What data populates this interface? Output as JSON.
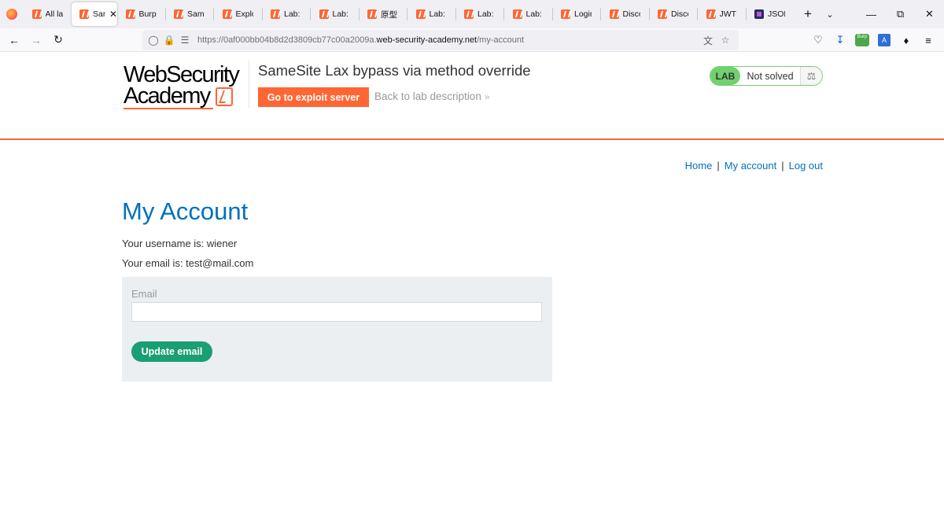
{
  "browser": {
    "tabs": [
      {
        "title": "All lab",
        "icon": "burp-favicon",
        "active": false
      },
      {
        "title": "Sam",
        "icon": "burp-favicon",
        "active": true
      },
      {
        "title": "Burp S",
        "icon": "burp-favicon",
        "active": false
      },
      {
        "title": "SameS",
        "icon": "burp-favicon",
        "active": false
      },
      {
        "title": "Exploi",
        "icon": "burp-favicon",
        "active": false
      },
      {
        "title": "Lab: S",
        "icon": "burp-favicon",
        "active": false
      },
      {
        "title": "Lab: D",
        "icon": "burp-favicon",
        "active": false
      },
      {
        "title": "原型污",
        "icon": "burp-favicon",
        "active": false
      },
      {
        "title": "Lab: C",
        "icon": "burp-favicon",
        "active": false
      },
      {
        "title": "Lab: D",
        "icon": "burp-favicon",
        "active": false
      },
      {
        "title": "Lab: D",
        "icon": "burp-favicon",
        "active": false
      },
      {
        "title": "Login",
        "icon": "burp-favicon",
        "active": false
      },
      {
        "title": "Discov",
        "icon": "burp-favicon",
        "active": false
      },
      {
        "title": "Discov",
        "icon": "burp-favicon",
        "active": false
      },
      {
        "title": "JWT at",
        "icon": "burp-favicon",
        "active": false
      },
      {
        "title": "JSON",
        "icon": "json-favicon",
        "active": false
      }
    ],
    "url_prefix": "https://0af000bb04b8d2d3809cb77c00a2009a.",
    "url_domain": "web-security-academy.net",
    "url_path": "/my-account"
  },
  "header": {
    "logo_line1": "WebSecurity",
    "logo_line2": "Academy",
    "lab_title": "SameSite Lax bypass via method override",
    "exploit_button": "Go to exploit server",
    "back_link": "Back to lab description",
    "status_badge": "LAB",
    "status_text": "Not solved",
    "colors": {
      "accent": "#ff6633",
      "lab_green": "#70d16d",
      "link_blue": "#0071bc",
      "button_green": "#1a9e73"
    }
  },
  "nav": {
    "home": "Home",
    "my_account": "My account",
    "log_out": "Log out",
    "separator": "|"
  },
  "account": {
    "title": "My Account",
    "username_line": "Your username is: wiener",
    "email_line": "Your email is: test@mail.com",
    "email_label": "Email",
    "email_value": "",
    "update_button": "Update email"
  }
}
